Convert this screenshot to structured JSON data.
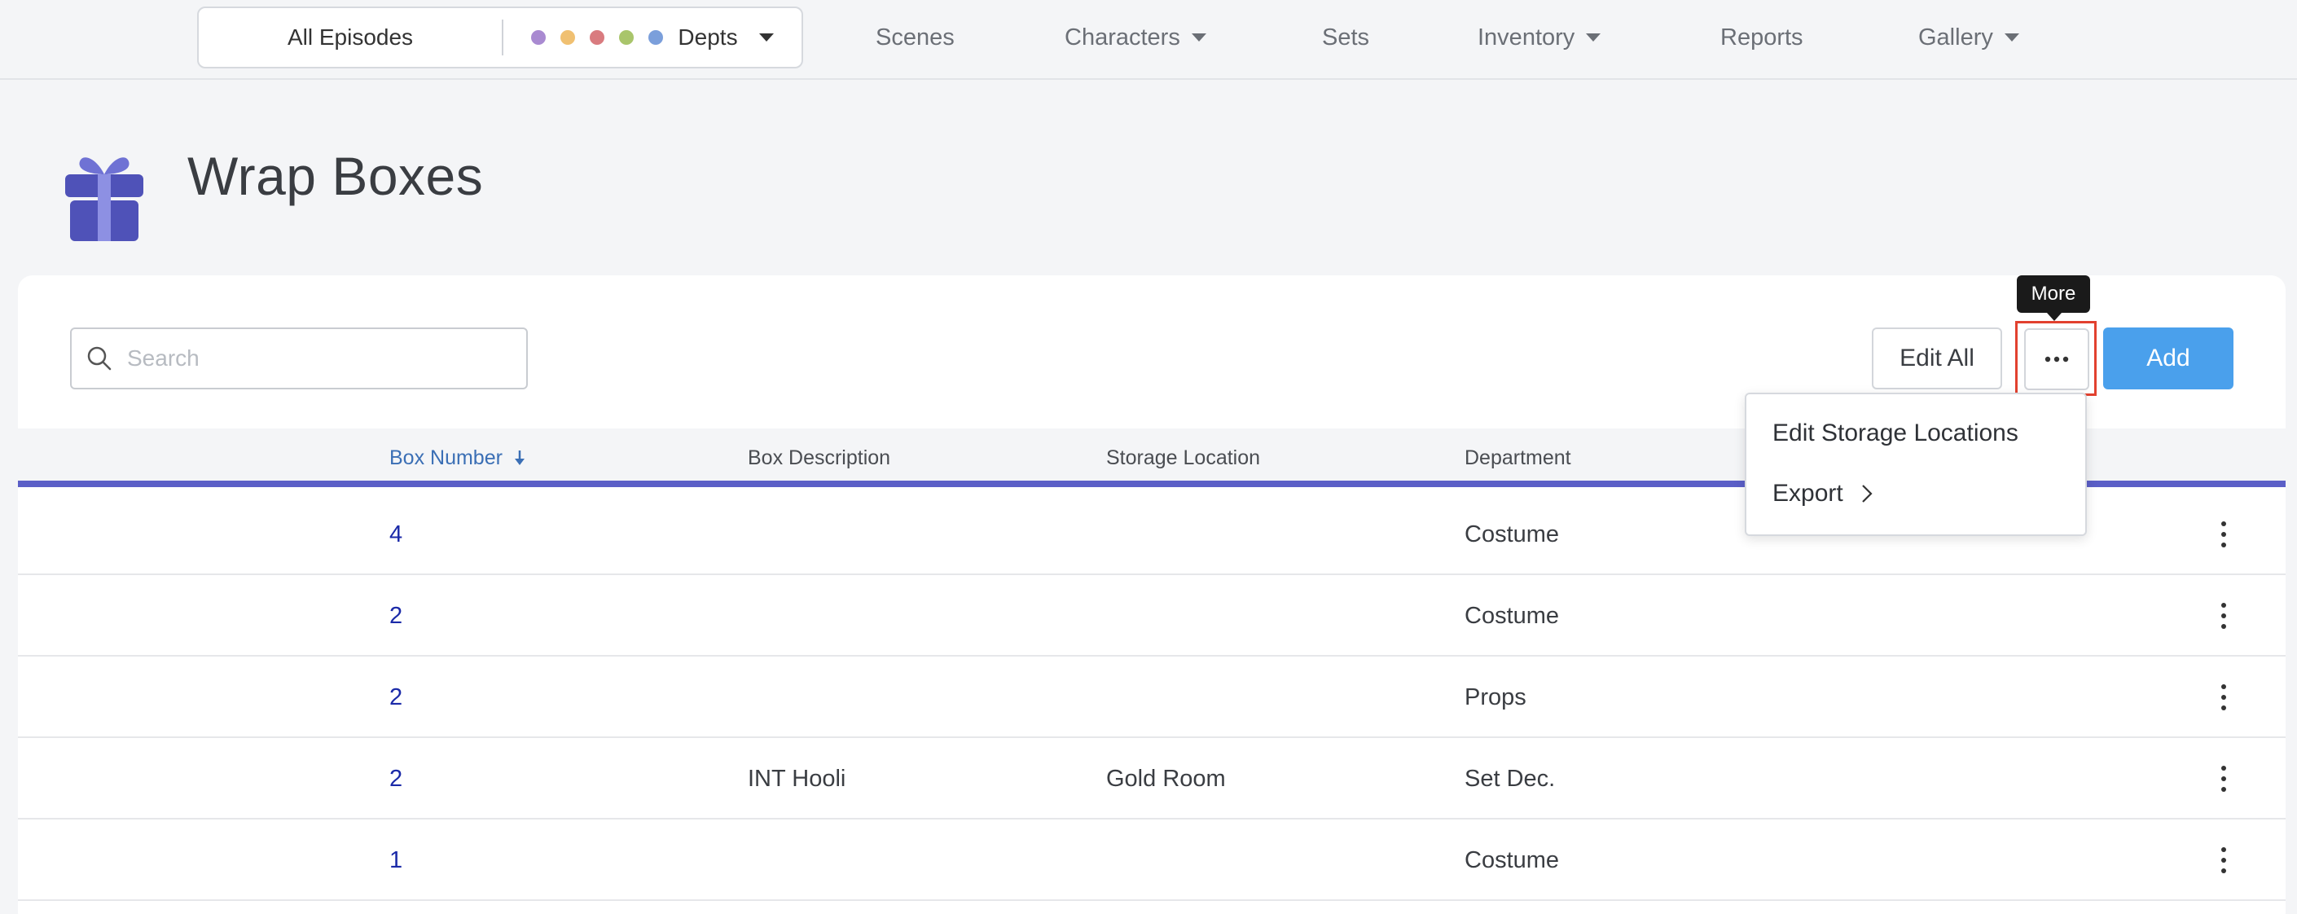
{
  "nav": {
    "filter": {
      "episodes_label": "All Episodes",
      "depts_label": "Depts",
      "dept_colors": [
        "#a98ad1",
        "#f0c071",
        "#d97b7f",
        "#a9c56b",
        "#7b9fdb"
      ]
    },
    "links": [
      {
        "label": "Scenes",
        "dropdown": false
      },
      {
        "label": "Characters",
        "dropdown": true
      },
      {
        "label": "Sets",
        "dropdown": false
      },
      {
        "label": "Inventory",
        "dropdown": true
      },
      {
        "label": "Reports",
        "dropdown": false
      },
      {
        "label": "Gallery",
        "dropdown": true
      }
    ]
  },
  "page": {
    "title": "Wrap Boxes",
    "icon": "gift-box-icon",
    "icon_color": "#4f52b8"
  },
  "toolbar": {
    "search_placeholder": "Search",
    "search_value": "",
    "edit_all_label": "Edit All",
    "more_tooltip": "More",
    "add_label": "Add",
    "add_color": "#4aa0ec"
  },
  "more_menu": {
    "items": [
      {
        "label": "Edit Storage Locations"
      },
      {
        "label": "Export"
      }
    ]
  },
  "table": {
    "columns": [
      "Box Number",
      "Box Description",
      "Storage Location",
      "Department"
    ],
    "sorted_column": "Box Number",
    "sort_direction": "descending",
    "rows": [
      {
        "box_number": "4",
        "description": "",
        "storage_location": "",
        "department": "Costume"
      },
      {
        "box_number": "2",
        "description": "",
        "storage_location": "",
        "department": "Costume"
      },
      {
        "box_number": "2",
        "description": "",
        "storage_location": "",
        "department": "Props"
      },
      {
        "box_number": "2",
        "description": "INT Hooli",
        "storage_location": "Gold Room",
        "department": "Set Dec."
      },
      {
        "box_number": "1",
        "description": "",
        "storage_location": "",
        "department": "Costume"
      }
    ]
  }
}
